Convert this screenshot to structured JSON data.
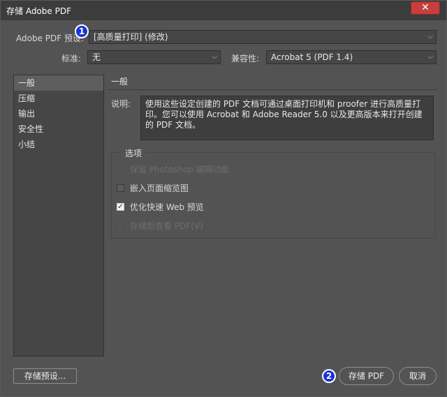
{
  "window": {
    "title": "存储 Adobe PDF",
    "close_glyph": "✕"
  },
  "preset": {
    "label": "Adobe PDF 预设:",
    "value": "[高质量打印] (修改)"
  },
  "standard": {
    "label": "标准:",
    "value": "无"
  },
  "compat": {
    "label": "兼容性:",
    "value": "Acrobat 5 (PDF 1.4)"
  },
  "nav": {
    "items": [
      "一般",
      "压缩",
      "输出",
      "安全性",
      "小结"
    ],
    "active_index": 0
  },
  "panel": {
    "title": "一般",
    "desc_label": "说明:",
    "desc_text": "使用这些设定创建的 PDF 文档可通过桌面打印机和 proofer 进行高质量打印。您可以使用 Acrobat 和 Adobe Reader 5.0 以及更高版本来打开创建的 PDF 文档。"
  },
  "options": {
    "title": "选项",
    "items": [
      {
        "label": "保留 Photoshop 编辑功能",
        "checked": false,
        "enabled": false
      },
      {
        "label": "嵌入页面缩览图",
        "checked": false,
        "enabled": true
      },
      {
        "label": "优化快速 Web 预览",
        "checked": true,
        "enabled": true
      },
      {
        "label": "存储后查看 PDF(V)",
        "checked": false,
        "enabled": false
      }
    ]
  },
  "buttons": {
    "save_preset": "存储预设...",
    "save_pdf": "存储 PDF",
    "cancel": "取消"
  },
  "markers": {
    "one": "1",
    "two": "2"
  },
  "icons": {
    "chevron": "⌵",
    "check": "✓"
  },
  "colors": {
    "marker": "#1a33d6",
    "close": "#c73e3e",
    "panel": "#535353"
  }
}
